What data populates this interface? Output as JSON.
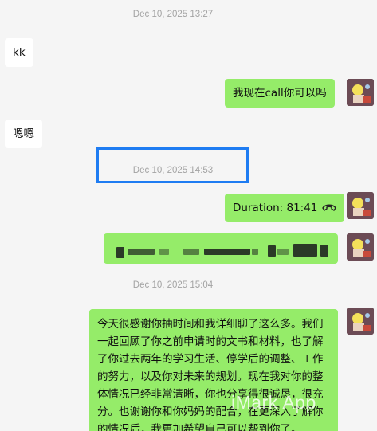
{
  "timestamps": {
    "t1": "Dec 10, 2025 13:27",
    "t2": "Dec 10, 2025 14:53",
    "t3": "Dec 10, 2025 15:04"
  },
  "messages": {
    "m1_text": "kk",
    "m2_text": "我现在call你可以吗",
    "m3_text": "嗯嗯",
    "m4_text": "Duration: 81:41",
    "m6_text": "今天很感谢你抽时间和我详细聊了这么多。我们一起回顾了你之前申请时的文书和材料，也了解了你过去两年的学习生活、停学后的调整、工作的努力，以及你对未来的规划。现在我对你的整体情况已经非常清晰，你也分享得很诚恳，很充分。也谢谢你和你妈妈的配合，在更深入了解你的情况后，我更加希望自己可以帮到你了。"
  },
  "icons": {
    "call": "phone-hangup-icon",
    "avatar": "user-avatar"
  },
  "watermark": "iMark App",
  "colors": {
    "background": "#f5f5f5",
    "bubble_self": "#95ec69",
    "bubble_other": "#ffffff",
    "highlight": "#1e7cf2"
  }
}
